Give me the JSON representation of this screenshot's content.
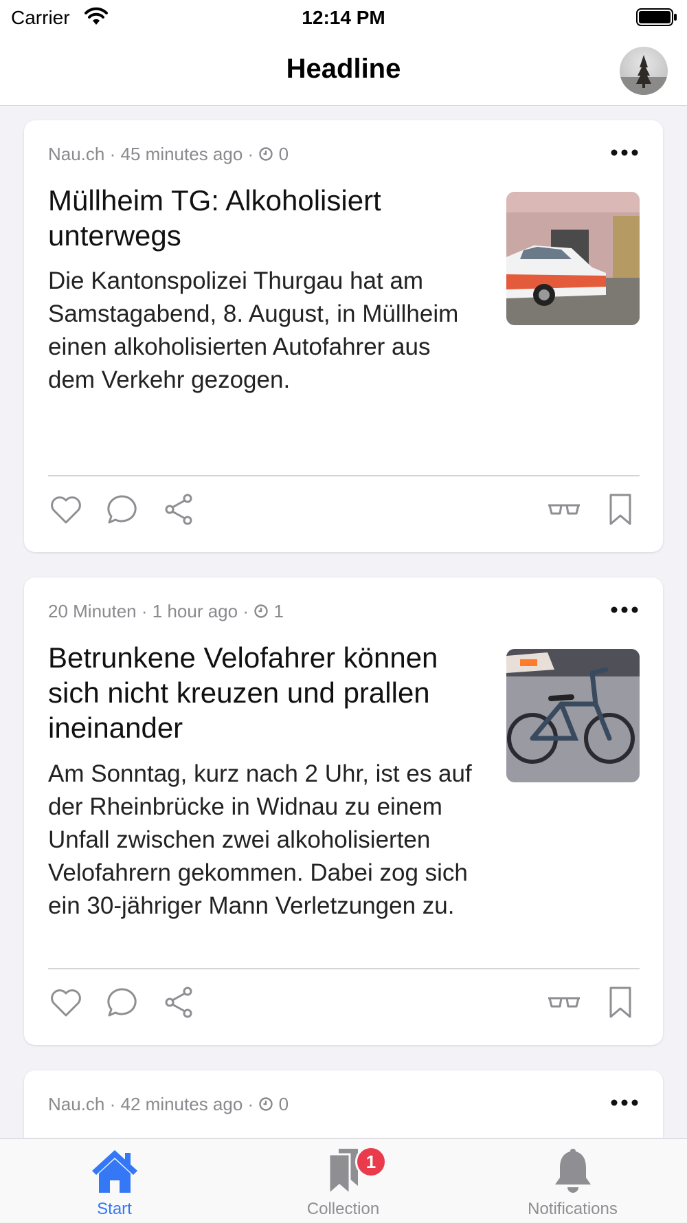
{
  "status_bar": {
    "carrier": "Carrier",
    "time": "12:14 PM"
  },
  "nav": {
    "title": "Headline"
  },
  "articles": [
    {
      "source": "Nau.ch",
      "time_ago": "45 minutes ago",
      "count": "0",
      "title": "Müllheim TG: Alkoholisiert unterwegs",
      "summary": "Die Kantonspolizei Thurgau hat am Samstagabend, 8. August, in Müllheim einen alkoholisierten Autofahrer aus dem Verkehr gezogen."
    },
    {
      "source": "20 Minuten",
      "time_ago": "1 hour ago",
      "count": "1",
      "title": "Betrunkene Velofahrer können sich nicht kreuzen und prallen ineinander",
      "summary": "Am Sonntag, kurz nach 2 Uhr, ist es auf der Rheinbrücke in Widnau zu einem Unfall zwischen zwei alkoholisierten Velofahrern gekommen. Dabei zog sich ein 30-jähriger Mann Verletzungen zu."
    },
    {
      "source": "Nau.ch",
      "time_ago": "42 minutes ago",
      "count": "0"
    }
  ],
  "tabs": [
    {
      "label": "Start",
      "icon": "house-icon",
      "active": true
    },
    {
      "label": "Collection",
      "icon": "bookmarks-icon",
      "badge": "1"
    },
    {
      "label": "Notifications",
      "icon": "bell-icon"
    }
  ],
  "colors": {
    "accent": "#3478f6",
    "badge": "#ea3b4c",
    "meta_text": "#8a8a8e",
    "icon_gray": "#8e8e93"
  }
}
